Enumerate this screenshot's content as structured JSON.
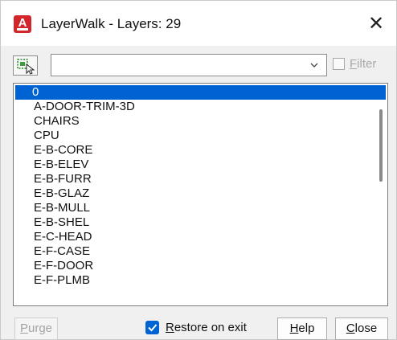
{
  "window": {
    "title": "LayerWalk - Layers: 29",
    "close_glyph": "✕"
  },
  "toolbar": {
    "select_objects_icon": "select-objects-icon",
    "filter_input_value": "",
    "filter_checked": false,
    "filter_label_first": "F",
    "filter_label_rest": "ilter"
  },
  "layers": {
    "selected": "0",
    "items": [
      "0",
      "A-DOOR-TRIM-3D",
      "CHAIRS",
      "CPU",
      "E-B-CORE",
      "E-B-ELEV",
      "E-B-FURR",
      "E-B-GLAZ",
      "E-B-MULL",
      "E-B-SHEL",
      "E-C-HEAD",
      "E-F-CASE",
      "E-F-DOOR",
      "E-F-PLMB"
    ]
  },
  "footer": {
    "purge_first": "P",
    "purge_rest": "urge",
    "restore_first": "R",
    "restore_rest": "estore on exit",
    "restore_checked": true,
    "help_first": "H",
    "help_rest": "elp",
    "close_first": "C",
    "close_rest": "lose"
  },
  "colors": {
    "accent": "#0063d3",
    "app_icon": "#d3262b"
  }
}
